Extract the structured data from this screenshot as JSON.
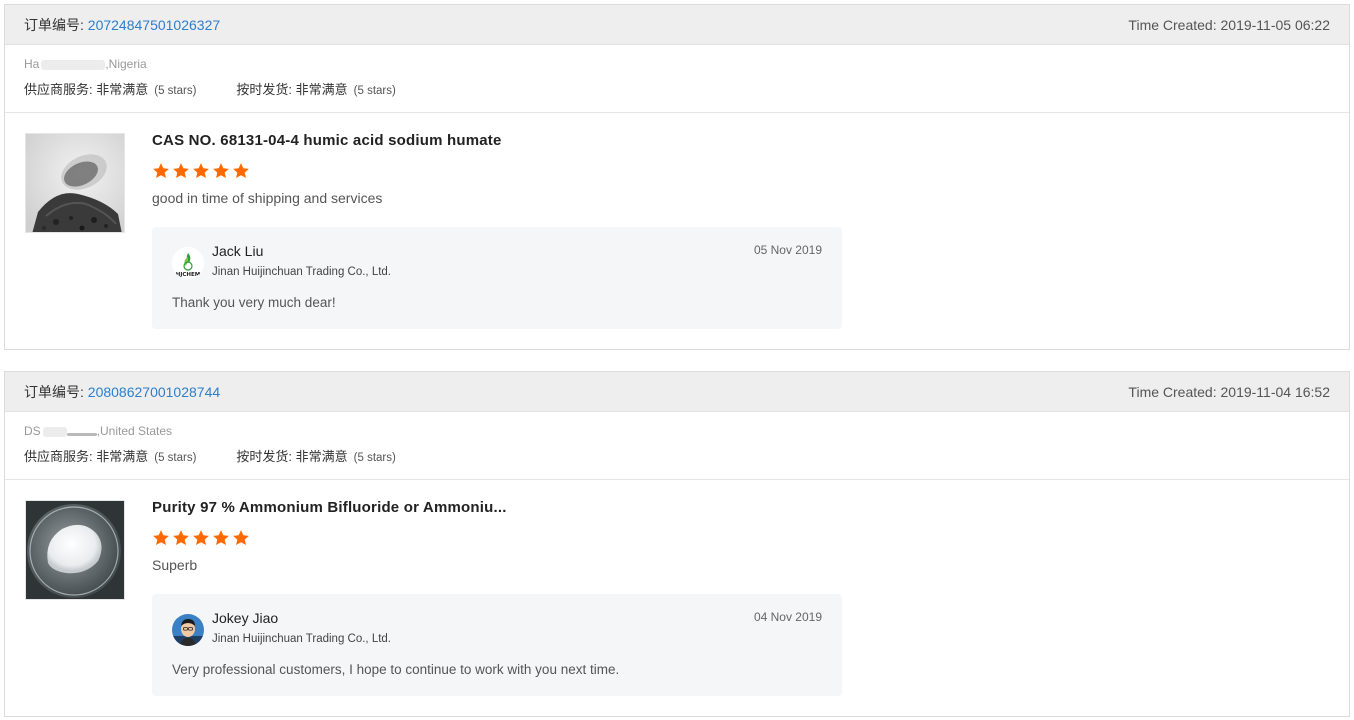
{
  "labels": {
    "order_label": "订单编号: ",
    "time_label": "Time Created: ",
    "supplier_service": "供应商服务: ",
    "on_time_shipping": "按时发货: ",
    "very_satisfied": "非常满意",
    "five_stars": "(5 stars)"
  },
  "colors": {
    "link": "#2f7ec8",
    "star": "#ff6a00"
  },
  "orders": [
    {
      "order_no": "20724847501026327",
      "time_created": "2019-11-05 06:22",
      "buyer_loc_prefix": "Ha",
      "buyer_loc_suffix": ",Nigeria",
      "product_title": "CAS NO. 68131-04-4 humic acid sodium humate",
      "rating": 5,
      "review": "good in time of shipping and services",
      "reply": {
        "name": "Jack Liu",
        "company": "Jinan Huijinchuan Trading Co., Ltd.",
        "date": "05 Nov 2019",
        "text": "Thank you very much dear!"
      }
    },
    {
      "order_no": "20808627001028744",
      "time_created": "2019-11-04 16:52",
      "buyer_loc_prefix": "DS",
      "buyer_loc_suffix": ",United States",
      "product_title": "Purity 97 % Ammonium Bifluoride or Ammoniu...",
      "rating": 5,
      "review": "Superb",
      "reply": {
        "name": "Jokey Jiao",
        "company": "Jinan Huijinchuan Trading Co., Ltd.",
        "date": "04 Nov 2019",
        "text": "Very professional customers, I hope to continue to work with you next time."
      }
    }
  ]
}
